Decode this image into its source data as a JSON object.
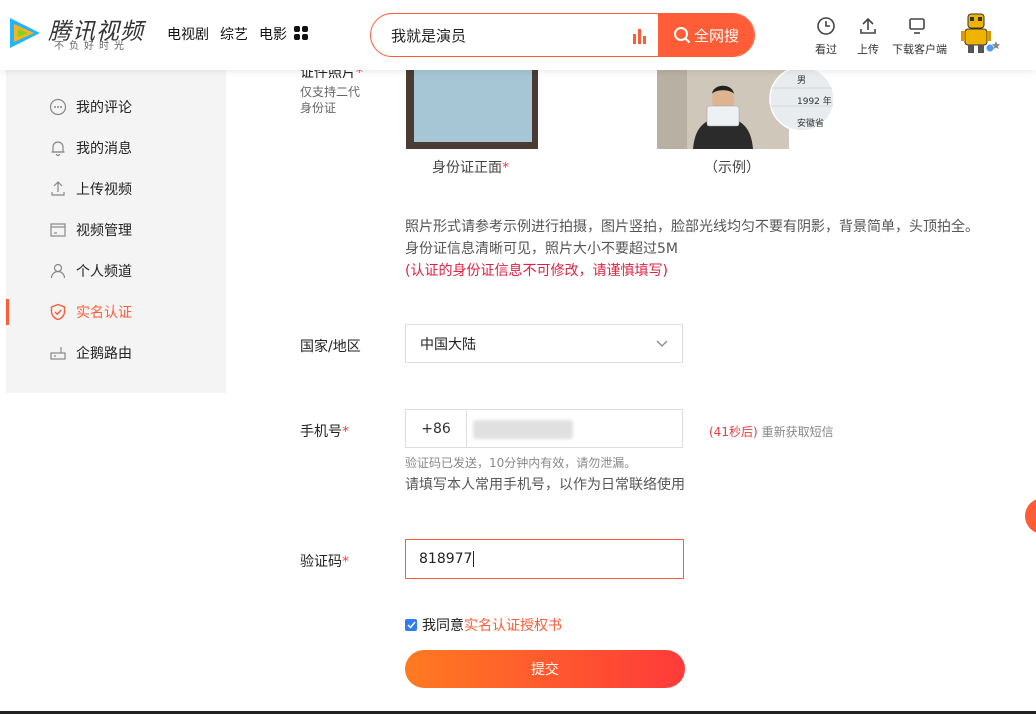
{
  "colors": {
    "accent": "#ff5c38",
    "required": "#ff3b3b",
    "warning": "#e02040",
    "checkbox": "#2f7cf6"
  },
  "header": {
    "logo_text": "腾讯视频",
    "logo_slogan": "不负好时光",
    "nav": [
      "电视剧",
      "综艺",
      "电影"
    ],
    "search_value": "我就是演员",
    "search_button": "全网搜",
    "tools": [
      {
        "label": "看过",
        "icon": "clock-icon"
      },
      {
        "label": "上传",
        "icon": "upload-icon"
      },
      {
        "label": "下载客户端",
        "icon": "monitor-icon"
      }
    ]
  },
  "sidebar": {
    "items": [
      {
        "label": "我的评论",
        "icon": "comment-icon"
      },
      {
        "label": "我的消息",
        "icon": "bell-icon"
      },
      {
        "label": "上传视频",
        "icon": "upload-icon"
      },
      {
        "label": "视频管理",
        "icon": "video-manage-icon"
      },
      {
        "label": "个人频道",
        "icon": "user-icon"
      },
      {
        "label": "实名认证",
        "icon": "shield-check-icon",
        "active": true
      },
      {
        "label": "企鹅路由",
        "icon": "router-icon"
      }
    ]
  },
  "form": {
    "photo_label": "证件照片",
    "photo_note_1": "仅支持二代",
    "photo_note_2": "身份证",
    "front_caption": "身份证正面",
    "example_caption": "（示例）",
    "example_card_text": [
      "男",
      "1992 年",
      "安徽省"
    ],
    "hint_line1": "照片形式请参考示例进行拍摄，图片竖拍，脸部光线均匀不要有阴影，背景简单，头顶拍全。",
    "hint_line2": "身份证信息清晰可见，照片大小不要超过5M",
    "hint_warning": "(认证的身份证信息不可修改，请谨慎填写)",
    "region_label": "国家/地区",
    "region_value": "中国大陆",
    "phone_label": "手机号",
    "phone_code": "+86",
    "countdown": "(41秒后)",
    "resend": "重新获取短信",
    "sms_sent_note": "验证码已发送，10分钟内有效，请勿泄漏。",
    "phone_hint": "请填写本人常用手机号，以作为日常联络使用",
    "code_label": "验证码",
    "code_value": "818977",
    "agree_prefix": "我同意",
    "agree_link": "实名认证授权书",
    "submit": "提交",
    "required_mark": "*"
  }
}
